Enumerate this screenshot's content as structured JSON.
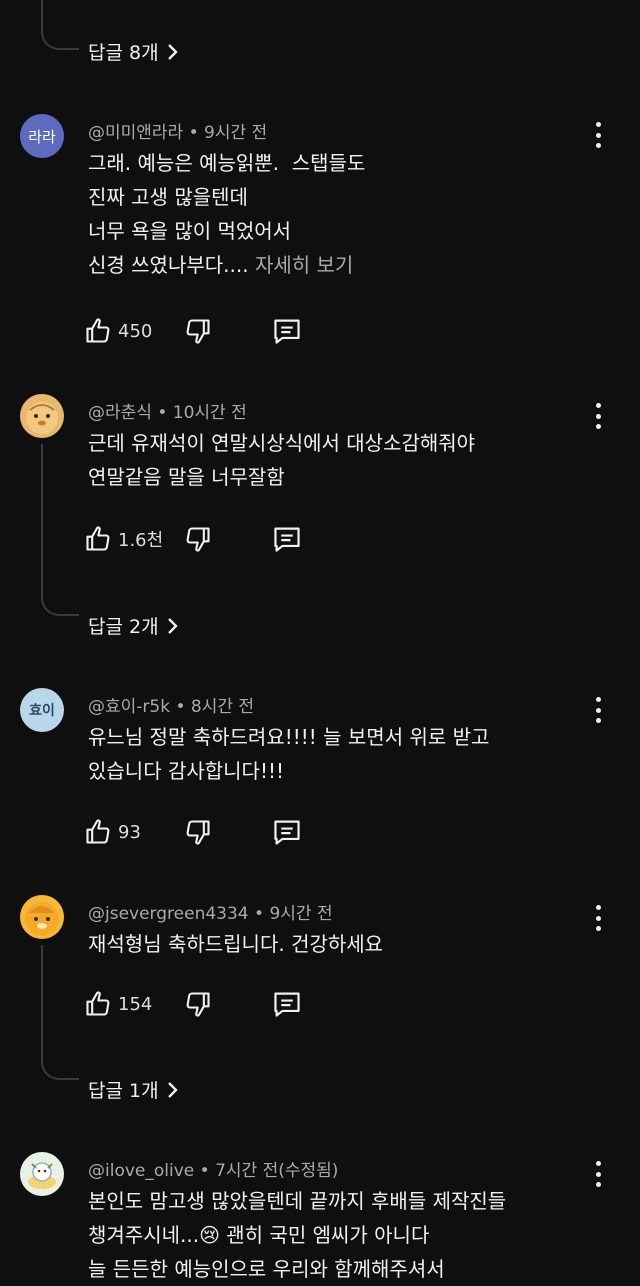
{
  "replies": [
    {
      "label": "답글 8개"
    },
    {
      "label": "답글 2개"
    },
    {
      "label": "답글 1개"
    }
  ],
  "comments": [
    {
      "avatar_text": "라라",
      "avatar_color": "#5c6bc0",
      "author": "@미미앤라라",
      "time": "9시간 전",
      "lines": [
        "그래. 예능은 예능읽뿐.  스탭들도",
        "진짜 고생 많을텐데",
        "너무 욕을 많이 먹었어서",
        "신경 쓰였나부다...."
      ],
      "more": "자세히 보기",
      "likes": "450"
    },
    {
      "avatar_text": "",
      "avatar_color": "#e8b86d",
      "author": "@라춘식",
      "time": "10시간 전",
      "lines": [
        "근데 유재석이 연말시상식에서 대상소감해줘야",
        "연말같음 말을 너무잘함"
      ],
      "likes": "1.6천"
    },
    {
      "avatar_text": "효이",
      "avatar_color": "#b9d7ea",
      "author": "@효이-r5k",
      "time": "8시간 전",
      "lines": [
        "유느님 정말 축하드려요!!!! 늘 보면서 위로 받고",
        "있습니다 감사합니다!!!"
      ],
      "likes": "93"
    },
    {
      "avatar_text": "",
      "avatar_color": "#f5b935",
      "author": "@jsevergreen4334",
      "time": "9시간 전",
      "lines": [
        "재석형님 축하드립니다. 건강하세요"
      ],
      "likes": "154"
    },
    {
      "avatar_text": "",
      "avatar_color": "#e9f0e6",
      "author": "@ilove_olive",
      "time": "7시간 전(수정됨)",
      "lines": [
        "본인도 맘고생 많았을텐데 끝까지 후배들 제작진들",
        "챙겨주시네...😢 괜히 국민 엠씨가 아니다",
        "늘 든든한 예능인으로 우리와 함께해주셔서"
      ]
    }
  ],
  "icons": {
    "like": "thumb-up-icon",
    "dislike": "thumb-down-icon",
    "reply": "comment-reply-icon",
    "menu": "more-vert-icon",
    "chevron": "chevron-right-icon"
  }
}
